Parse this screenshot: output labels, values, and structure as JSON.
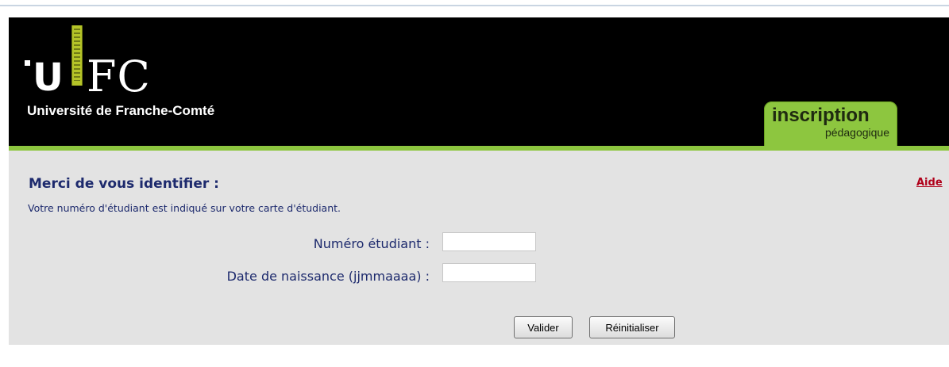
{
  "header": {
    "logo_u": "U",
    "logo_fc": "FC",
    "university": "Université de Franche-Comté",
    "tab_title": "inscription",
    "tab_subtitle": "pédagogique"
  },
  "form": {
    "title": "Merci de vous identifier :",
    "help_link": "Aide",
    "hint": "Votre numéro d'étudiant est indiqué sur votre carte d'étudiant.",
    "student_number_label": "Numéro étudiant :",
    "student_number_value": "",
    "birthdate_label": "Date de naissance (jjmmaaaa) :",
    "birthdate_value": "",
    "submit_label": "Valider",
    "reset_label": "Réinitialiser"
  },
  "colors": {
    "header_bg": "#000000",
    "accent_green": "#8dc63f",
    "panel_bg": "#e3e3e3",
    "text_navy": "#1d2a6d",
    "link_red": "#b0001a"
  },
  "icons": {
    "logo_bar": "ruler-bar-logo"
  }
}
